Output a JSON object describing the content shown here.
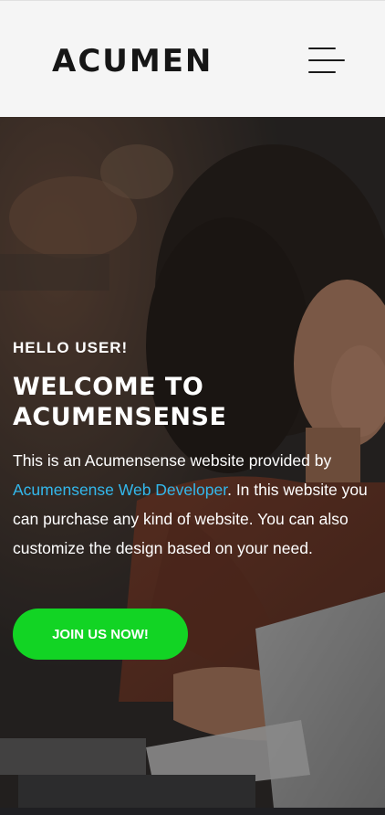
{
  "header": {
    "brand": "ACUMEN",
    "menu_icon": "hamburger-menu-icon"
  },
  "hero": {
    "greeting": "HELLO USER!",
    "title": "WELCOME TO ACUMENSENSE",
    "description_before": "This is an Acumensense website provided by ",
    "description_link": "Acumensense Web Developer",
    "description_after": ". In this website you can purchase any kind of website. You can also customize the design based on your need.",
    "cta_label": "JOIN US NOW!",
    "background_image": "woman-working-on-laptop-photo"
  },
  "colors": {
    "header_bg": "#f5f5f5",
    "link": "#33b8ec",
    "cta": "#12d424",
    "text_on_hero": "#ffffff"
  }
}
